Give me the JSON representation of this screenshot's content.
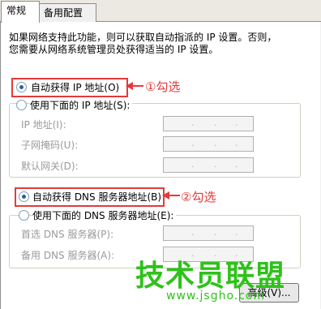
{
  "tabs": {
    "general": "常规",
    "alternate": "备用配置"
  },
  "description": {
    "line1": "如果网络支持此功能，则可以获取自动指派的 IP 设置。否则，",
    "line2": "您需要从网络系统管理员处获得适当的 IP 设置。"
  },
  "ip": {
    "auto_label": "自动获得 IP 地址(O)",
    "auto_selected": true,
    "manual_label": "使用下面的 IP 地址(S):",
    "fields": [
      {
        "label": "IP 地址(I):"
      },
      {
        "label": "子网掩码(U):"
      },
      {
        "label": "默认网关(D):"
      }
    ]
  },
  "dns": {
    "auto_label": "自动获得 DNS 服务器地址(B)",
    "auto_selected": true,
    "manual_label": "使用下面的 DNS 服务器地址(E):",
    "fields": [
      {
        "label": "首选 DNS 服务器(P):"
      },
      {
        "label": "备用 DNS 服务器(A):"
      }
    ]
  },
  "annotations": {
    "step1": "①勾选",
    "step2": "②勾选",
    "color": "#e23b3b"
  },
  "watermark": {
    "cn": "技术员联盟",
    "url": "www.jsgho.com",
    "color": "#2ec21a"
  },
  "buttons": {
    "advanced": "高级(V)..."
  }
}
